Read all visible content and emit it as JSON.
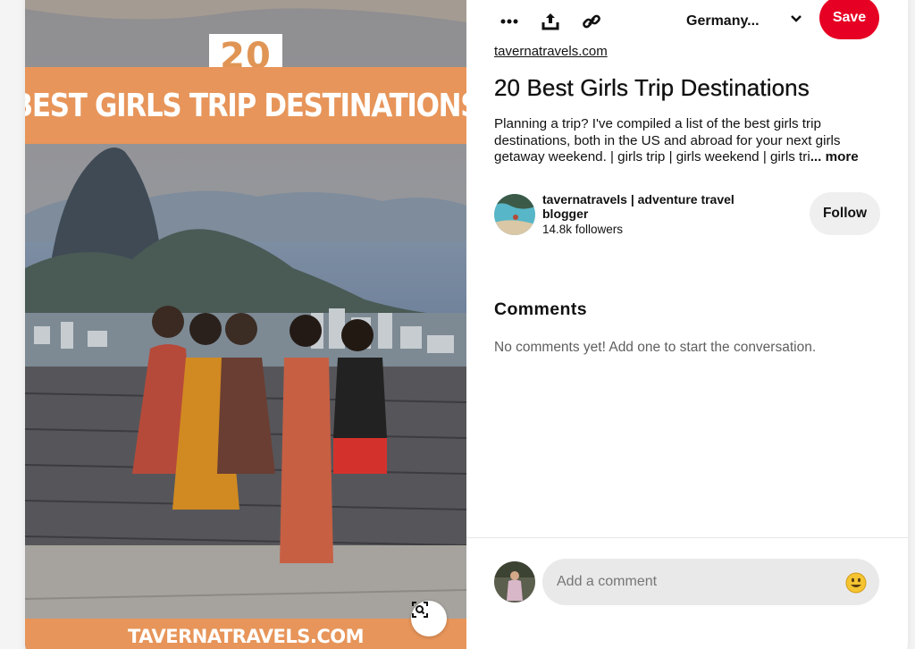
{
  "pin": {
    "image_number": "20",
    "image_headline": "BEST GIRLS TRIP DESTINATIONS",
    "image_footer": "TAVERNATRAVELS.COM"
  },
  "toolbar": {
    "more_icon": "ellipsis-icon",
    "share_icon": "share-icon",
    "link_icon": "link-icon",
    "board_name": "Germany...",
    "save_label": "Save"
  },
  "details": {
    "source": "tavernatravels.com",
    "title": "20 Best Girls Trip Destinations",
    "description": "Planning a trip? I've compiled a list of the best girls trip destinations, both in the US and abroad for your next girls getaway weekend. | girls trip | girls weekend | girls tri",
    "more_label": "... more"
  },
  "creator": {
    "name": "tavernatravels | adventure travel blogger",
    "followers": "14.8k followers",
    "follow_label": "Follow"
  },
  "comments": {
    "heading": "Comments",
    "empty_text": "No comments yet! Add one to start the conversation.",
    "input_placeholder": "Add a comment",
    "emoji_icon": "smiley-icon"
  },
  "colors": {
    "save_red": "#e60023",
    "banner_orange": "#e7955a"
  }
}
